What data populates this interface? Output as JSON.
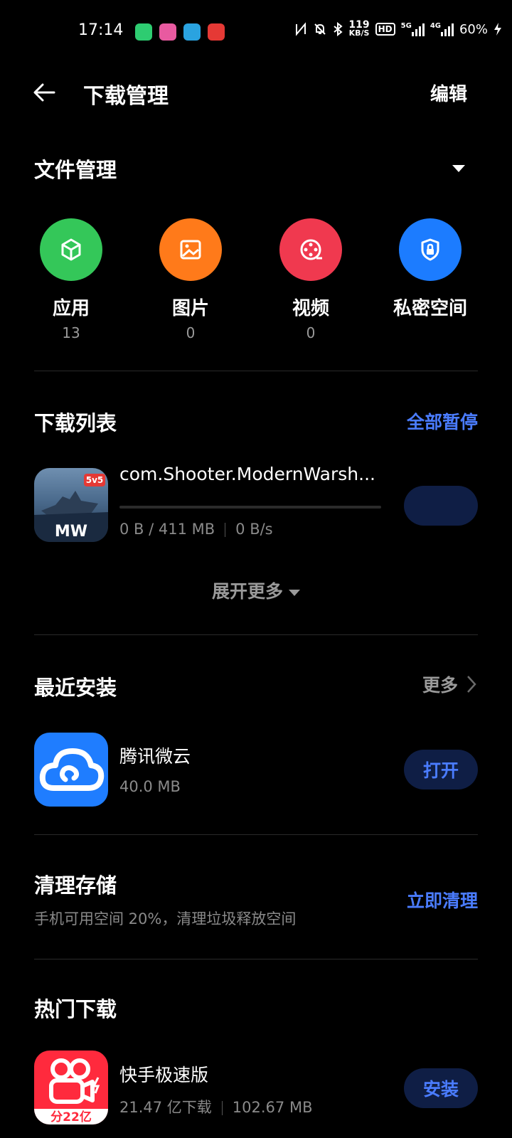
{
  "status_bar": {
    "time": "17:14",
    "net_speed_value": "119",
    "net_speed_unit": "KB/S",
    "hd_label": "HD",
    "sim1_label": "5G",
    "sim2_label": "4G",
    "battery": "60%"
  },
  "header": {
    "title": "下载管理",
    "edit_label": "编辑"
  },
  "file_management": {
    "title": "文件管理",
    "items": [
      {
        "label": "应用",
        "count": "13",
        "color": "#34c759",
        "icon": "cube-icon"
      },
      {
        "label": "图片",
        "count": "0",
        "color": "#ff7a1a",
        "icon": "image-icon"
      },
      {
        "label": "视频",
        "count": "0",
        "color": "#f0394f",
        "icon": "film-reel-icon"
      },
      {
        "label": "私密空间",
        "count": "",
        "color": "#1c7cff",
        "icon": "shield-lock-icon"
      }
    ]
  },
  "download_list": {
    "title": "下载列表",
    "pause_all": "全部暂停",
    "items": [
      {
        "name": "com.Shooter.ModernWarsh...",
        "progress": "0 B / 411 MB",
        "speed": "0 B/s",
        "progress_fraction": 0,
        "icon_badge": "5v5",
        "icon_logo": "MW"
      }
    ],
    "expand_more": "展开更多"
  },
  "recent_installs": {
    "title": "最近安装",
    "more_label": "更多",
    "items": [
      {
        "name": "腾讯微云",
        "size": "40.0 MB",
        "action": "打开"
      }
    ]
  },
  "clean_storage": {
    "title": "清理存储",
    "subtitle": "手机可用空间 20%，清理垃圾释放空间",
    "action": "立即清理"
  },
  "hot_downloads": {
    "title": "热门下载",
    "items": [
      {
        "name": "快手极速版",
        "downloads": "21.47 亿下载",
        "size": "102.67 MB",
        "action": "安装",
        "icon_text": "分22亿"
      }
    ]
  },
  "colors": {
    "accent": "#4a7cff",
    "button_bg": "#0f1e45",
    "background": "#000000"
  }
}
